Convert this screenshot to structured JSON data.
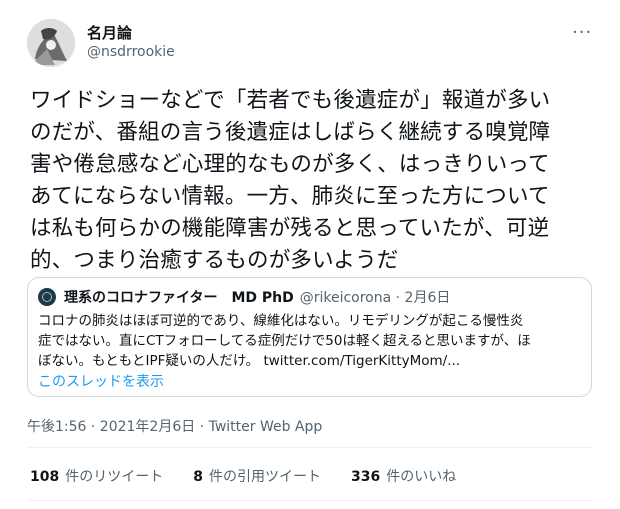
{
  "author": {
    "name": "名月論",
    "handle": "@nsdrrookie"
  },
  "tweet": {
    "text": "ワイドショーなどで「若者でも後遺症が」報道が多い\nのだが、番組の言う後遺症はしばらく継続する嗅覚障\n害や倦怠感など心理的なものが多く、はっきりいって\nあてにならない情報。一方、肺炎に至った方について\nは私も何らかの機能障害が残ると思っていたが、可逆\n的、つまり治癒するものが多いようだ"
  },
  "quoted": {
    "name": "理系のコロナファイター　MD PhD",
    "handle_date": "@rikeicorona · 2月6日",
    "text": "コロナの肺炎はほぼ可逆的であり、線維化はない。リモデリングが起こる慢性炎\n症ではない。直にCTフォローしてる症例だけで50は軽く超えると思いますが、ほ\nぼない。もともとIPF疑いの人だけ。 twitter.com/TigerKittyMom/...",
    "thread_link": "このスレッドを表示"
  },
  "meta": "午後1:56 · 2021年2月6日 · Twitter Web App",
  "stats": [
    {
      "count": "108",
      "label": "件のリツイート"
    },
    {
      "count": "8",
      "label": "件の引用ツイート"
    },
    {
      "count": "336",
      "label": "件のいいね"
    }
  ],
  "icons": {
    "more": "more-horizontal-icon"
  }
}
